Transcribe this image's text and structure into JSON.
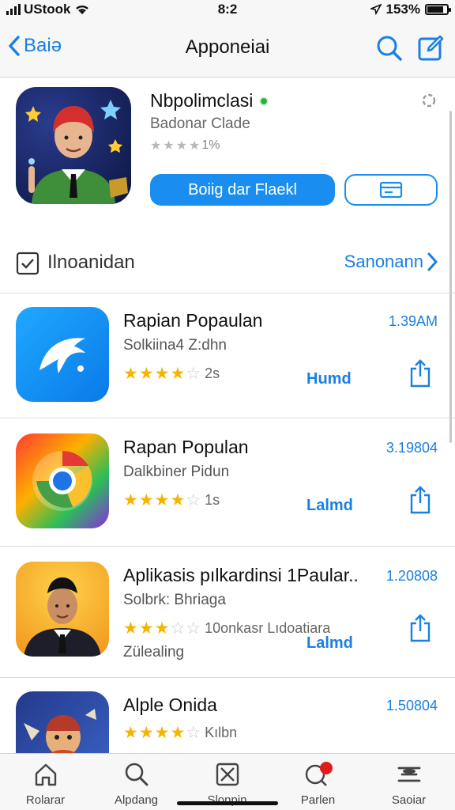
{
  "status": {
    "carrier": "UStook",
    "time": "8:2",
    "battery": "153%",
    "battery_level": 0.85
  },
  "nav": {
    "back_label": "Baiə",
    "title": "Apponeiai"
  },
  "featured": {
    "title": "Nbpolimclasi",
    "subtitle": "Badonar Clade",
    "rating_text": "1%",
    "rating_stars": 4,
    "primary_button": "Boiig dar Flaekl"
  },
  "section": {
    "label": "Ilnoanidan",
    "link": "Sanonann"
  },
  "apps": [
    {
      "title": "Rapian Popaulan",
      "subtitle": "Solkiina4 Z:dhn",
      "stars": 3.5,
      "count": "2s",
      "time": "1.39AM",
      "action": "Humd",
      "icon": "pigeon-app-icon"
    },
    {
      "title": "Rapan Populan",
      "subtitle": "Dalkbiner Pidun",
      "stars": 4,
      "count": "1s",
      "time": "3.19804",
      "action": "Lalmd",
      "icon": "chrome-like-app-icon"
    },
    {
      "title": "Aplikasis pılkardinsi 1Paular..",
      "subtitle": "Solbrk: Bhriaga",
      "stars": 3,
      "count": "10onkasr Lıdoatiara",
      "extra": "Zülealing",
      "time": "1.20808",
      "action": "Lalmd",
      "icon": "portrait-app-icon"
    },
    {
      "title": "Alple Onida",
      "subtitle": "",
      "stars": 4,
      "count": "Kılbn",
      "time": "1.50804",
      "action": "",
      "icon": "cartoon-app-icon"
    }
  ],
  "tabs": [
    {
      "label": "Rolarar",
      "icon": "home-icon"
    },
    {
      "label": "Alpdang",
      "icon": "search-icon"
    },
    {
      "label": "Slonpin",
      "icon": "box-icon"
    },
    {
      "label": "Parlen",
      "icon": "notification-icon"
    },
    {
      "label": "Saoiar",
      "icon": "stack-icon"
    }
  ],
  "colors": {
    "accent": "#1a8ef0",
    "star": "#f5b400",
    "badge": "#e11b1b",
    "online": "#27b33a"
  }
}
